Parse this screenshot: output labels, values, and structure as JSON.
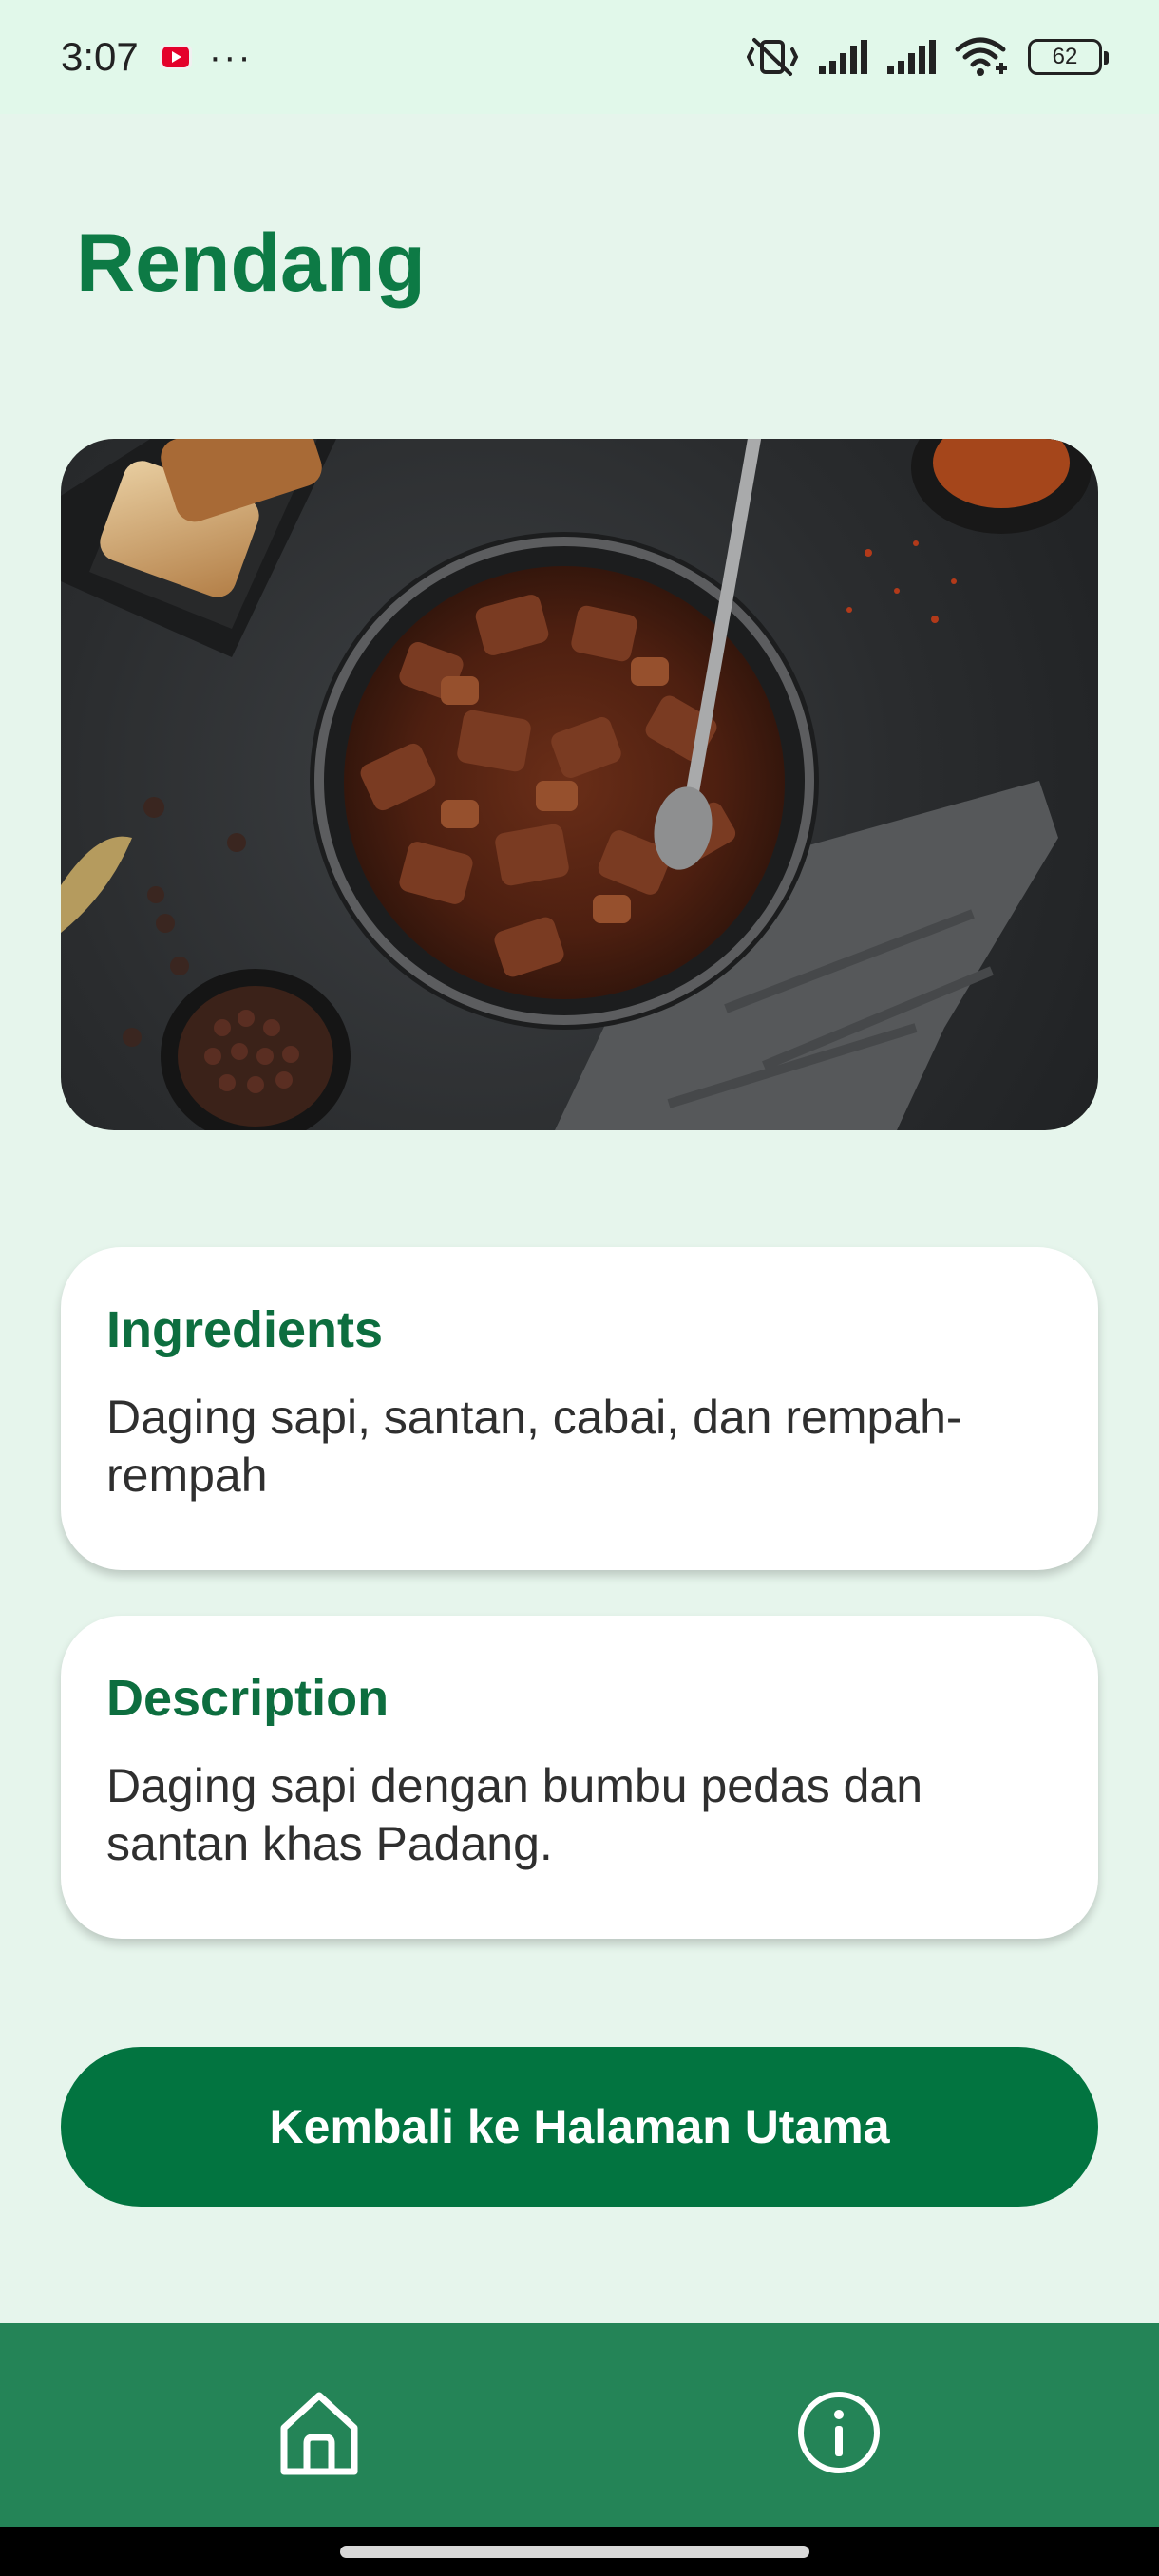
{
  "status_bar": {
    "time": "3:07",
    "dots": "···",
    "battery_level": "62",
    "icons": [
      "youtube-notification-icon",
      "more-notifications-icon",
      "vibrate-off-icon",
      "signal-icon",
      "signal-icon",
      "wifi-icon",
      "battery-icon"
    ]
  },
  "page": {
    "title": "Rendang"
  },
  "hero_image": {
    "subject": "rendang-dish-photo"
  },
  "ingredients": {
    "title": "Ingredients",
    "text": "Daging sapi, santan, cabai, dan rempah-rempah"
  },
  "description": {
    "title": "Description",
    "text": "Daging sapi dengan bumbu pedas dan santan khas Padang."
  },
  "back_button": {
    "label": "Kembali ke Halaman Utama"
  },
  "bottom_nav": {
    "items": [
      {
        "icon": "home-icon"
      },
      {
        "icon": "info-icon"
      }
    ]
  },
  "colors": {
    "background": "#e6f5ec",
    "accent": "#0d7a45",
    "button": "#027440",
    "nav": "#248457"
  }
}
